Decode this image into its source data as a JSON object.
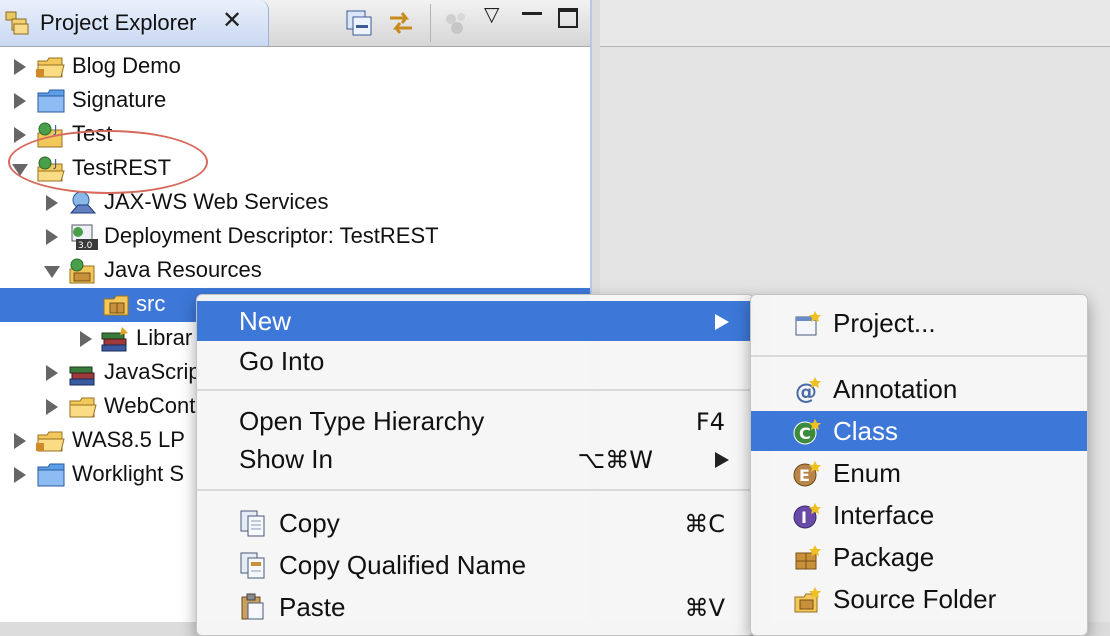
{
  "view": {
    "title": "Project Explorer",
    "close_glyph": "✕"
  },
  "tree": [
    {
      "label": "Blog Demo",
      "icon": "project-folder-icon",
      "state": "closed"
    },
    {
      "label": "Signature",
      "icon": "folder-icon",
      "state": "closed"
    },
    {
      "label": "Test",
      "icon": "web-project-icon",
      "state": "closed"
    },
    {
      "label": "TestREST",
      "icon": "web-project-icon",
      "state": "open"
    },
    {
      "label": "JAX-WS Web Services",
      "icon": "web-services-icon",
      "state": "closed"
    },
    {
      "label": "Deployment Descriptor: TestREST",
      "icon": "deployment-descriptor-icon",
      "state": "closed"
    },
    {
      "label": "Java Resources",
      "icon": "java-resources-icon",
      "state": "open"
    },
    {
      "label": "src",
      "icon": "package-folder-icon",
      "state": "none"
    },
    {
      "label": "Librar",
      "icon": "libraries-icon",
      "state": "closed"
    },
    {
      "label": "JavaScrip",
      "icon": "javascript-resources-icon",
      "state": "closed"
    },
    {
      "label": "WebCont",
      "icon": "folder-icon",
      "state": "closed"
    },
    {
      "label": "WAS8.5 LP",
      "icon": "project-folder-icon",
      "state": "closed"
    },
    {
      "label": "Worklight S",
      "icon": "folder-icon",
      "state": "closed"
    }
  ],
  "context_menu": {
    "new": "New",
    "go_into": "Go Into",
    "open_type_hierarchy": "Open Type Hierarchy",
    "open_type_hierarchy_shortcut": "F4",
    "show_in": "Show In",
    "show_in_shortcut": "⌥⌘W",
    "copy": "Copy",
    "copy_shortcut": "⌘C",
    "copy_qualified_name": "Copy Qualified Name",
    "paste": "Paste",
    "paste_shortcut": "⌘V"
  },
  "submenu": {
    "project": "Project...",
    "annotation": "Annotation",
    "class": "Class",
    "enum": "Enum",
    "interface": "Interface",
    "package": "Package",
    "source_folder": "Source Folder"
  },
  "colors": {
    "selection": "#3d78d8",
    "highlight_ellipse": "#d66a5c"
  }
}
